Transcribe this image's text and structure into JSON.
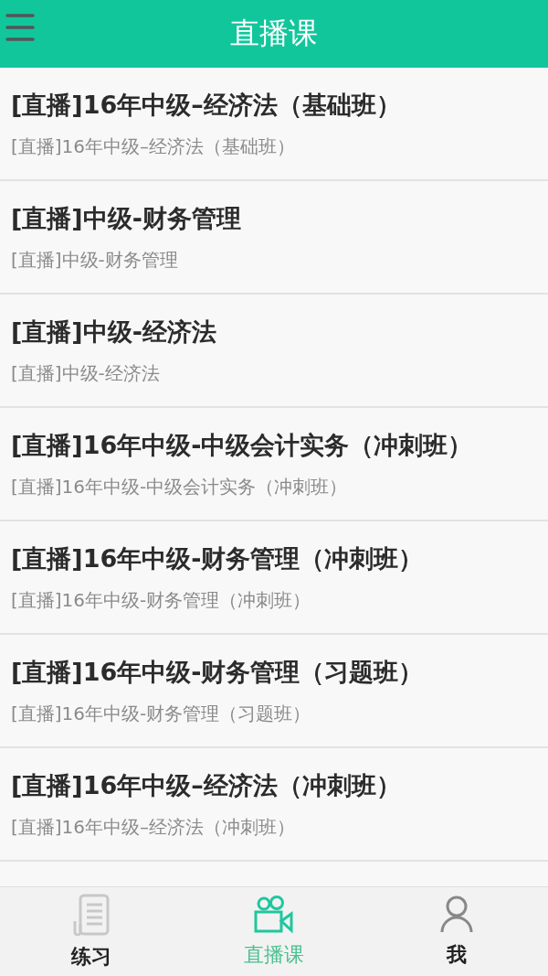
{
  "header": {
    "title": "直播课"
  },
  "courses": [
    {
      "title": "[直播]16年中级–经济法（基础班）",
      "subtitle": "[直播]16年中级–经济法（基础班）"
    },
    {
      "title": "[直播]中级-财务管理",
      "subtitle": "[直播]中级-财务管理"
    },
    {
      "title": "[直播]中级-经济法",
      "subtitle": "[直播]中级-经济法"
    },
    {
      "title": "[直播]16年中级-中级会计实务（冲刺班）",
      "subtitle": "[直播]16年中级-中级会计实务（冲刺班）"
    },
    {
      "title": "[直播]16年中级-财务管理（冲刺班）",
      "subtitle": "[直播]16年中级-财务管理（冲刺班）"
    },
    {
      "title": "[直播]16年中级-财务管理（习题班）",
      "subtitle": "[直播]16年中级-财务管理（习题班）"
    },
    {
      "title": "[直播]16年中级–经济法（冲刺班）",
      "subtitle": "[直播]16年中级–经济法（冲刺班）"
    }
  ],
  "tabs": [
    {
      "kind": "practice",
      "label": "练习",
      "selected": false
    },
    {
      "kind": "live",
      "label": "直播课",
      "selected": true
    },
    {
      "kind": "me",
      "label": "我",
      "selected": false
    }
  ]
}
